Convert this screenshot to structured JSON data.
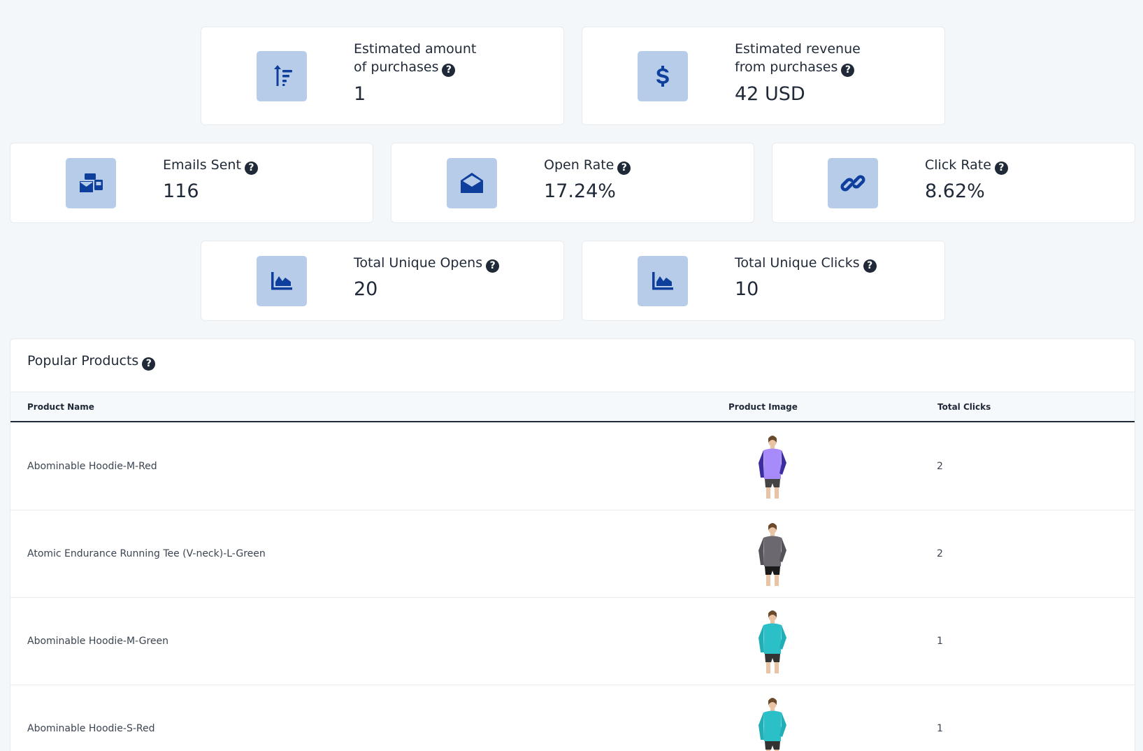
{
  "stats": {
    "purchases": {
      "title_line1": "Estimated amount",
      "title_line2": "of purchases",
      "value": "1",
      "icon": "sort-amount-icon"
    },
    "revenue": {
      "title_line1": "Estimated revenue",
      "title_line2": "from purchases",
      "value": "42 USD",
      "icon": "dollar-icon"
    },
    "emails_sent": {
      "title": "Emails Sent",
      "value": "116",
      "icon": "mail-bulk-icon"
    },
    "open_rate": {
      "title": "Open Rate",
      "value": "17.24%",
      "icon": "envelope-open-icon"
    },
    "click_rate": {
      "title": "Click Rate",
      "value": "8.62%",
      "icon": "link-icon"
    },
    "unique_opens": {
      "title": "Total Unique Opens",
      "value": "20",
      "icon": "area-chart-icon"
    },
    "unique_clicks": {
      "title": "Total Unique Clicks",
      "value": "10",
      "icon": "area-chart-icon"
    }
  },
  "help_glyph": "?",
  "products": {
    "title": "Popular Products",
    "columns": {
      "name": "Product Name",
      "image": "Product Image",
      "clicks": "Total Clicks"
    },
    "rows": [
      {
        "name": "Abominable Hoodie-M-Red",
        "clicks": "2",
        "shirt_color": "#a78bfa",
        "sleeve_color": "#3b2fa0",
        "pants_color": "#444444"
      },
      {
        "name": "Atomic Endurance Running Tee (V-neck)-L-Green",
        "clicks": "2",
        "shirt_color": "#6b6870",
        "sleeve_color": "#55525a",
        "pants_color": "#1a1a1a"
      },
      {
        "name": "Abominable Hoodie-M-Green",
        "clicks": "1",
        "shirt_color": "#2bbfc7",
        "sleeve_color": "#22aeb6",
        "pants_color": "#333333"
      },
      {
        "name": "Abominable Hoodie-S-Red",
        "clicks": "1",
        "shirt_color": "#2bbfc7",
        "sleeve_color": "#22aeb6",
        "pants_color": "#333333"
      }
    ]
  },
  "colors": {
    "accent": "#0f3f9c",
    "icon_bg": "#b7cce9",
    "page_bg": "#f4f7fa"
  }
}
